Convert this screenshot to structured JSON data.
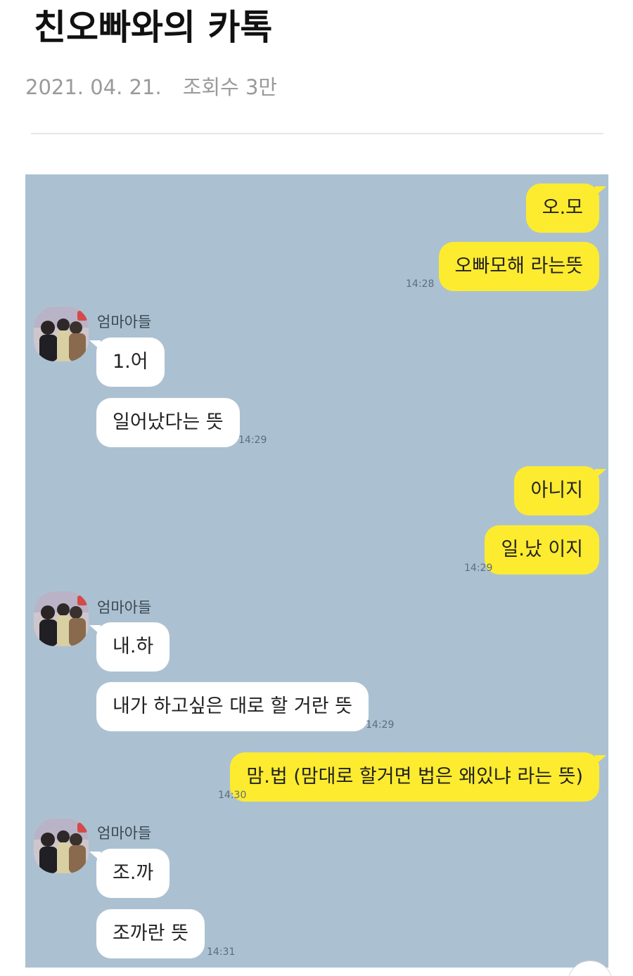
{
  "post": {
    "title": "친오빠와의 카톡",
    "date": "2021. 04. 21.",
    "views": "조회수 3만"
  },
  "chat": {
    "background_color": "#abc1d2",
    "my_bubble_color": "#fdeb2f",
    "their_bubble_color": "#ffffff",
    "sender_name": "엄마아들",
    "blocks": [
      {
        "side": "me",
        "messages": [
          "오.모",
          "오빠모해 라는뜻"
        ],
        "time": "14:28"
      },
      {
        "side": "them",
        "messages": [
          "1.어",
          "일어났다는 뜻"
        ],
        "time": "14:29"
      },
      {
        "side": "me",
        "messages": [
          "아니지",
          "일.났 이지"
        ],
        "time": "14:29"
      },
      {
        "side": "them",
        "messages": [
          "내.하",
          "내가 하고싶은 대로 할 거란 뜻"
        ],
        "time": "14:29"
      },
      {
        "side": "me",
        "messages": [
          "맘.법 (맘대로 할거면 법은 왜있냐 라는 뜻)"
        ],
        "time": "14:30"
      },
      {
        "side": "them",
        "messages": [
          "조.까",
          "조까란 뜻"
        ],
        "time": "14:31"
      }
    ]
  }
}
